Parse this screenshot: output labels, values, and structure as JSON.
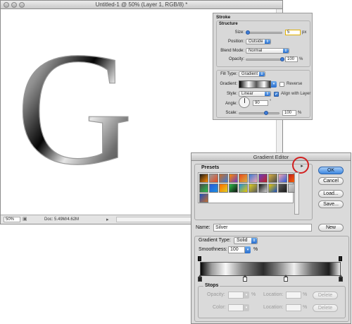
{
  "document": {
    "title": "Untitled-1 @ 50% (Layer 1, RGB/8) *",
    "zoom": "50%",
    "doc_info": "Doc: 5.49M/4.62M",
    "canvas_letter": "G"
  },
  "stroke_panel": {
    "title": "Stroke",
    "structure_heading": "Structure",
    "size_label": "Size:",
    "size_value": "5",
    "size_unit": "px",
    "size_slider_level": 0.05,
    "position_label": "Position:",
    "position_value": "Outside",
    "blend_label": "Blend Mode:",
    "blend_value": "Normal",
    "opacity_label": "Opacity:",
    "opacity_value": "100",
    "opacity_unit": "%",
    "fill_type_label": "Fill Type:",
    "fill_type_value": "Gradient",
    "gradient_label": "Gradient:",
    "reverse_label": "Reverse",
    "reverse_checked": false,
    "style_label": "Style:",
    "style_value": "Linear",
    "align_label": "Align with Layer",
    "align_checked": true,
    "angle_label": "Angle:",
    "angle_value": "90",
    "angle_unit": "°",
    "scale_label": "Scale:",
    "scale_value": "100",
    "scale_unit": "%"
  },
  "gradient_editor": {
    "title": "Gradient Editor",
    "presets_label": "Presets",
    "ok_label": "OK",
    "cancel_label": "Cancel",
    "load_label": "Load...",
    "save_label": "Save...",
    "name_label": "Name:",
    "name_value": "Silver",
    "new_label": "New",
    "gradient_type_label": "Gradient Type:",
    "gradient_type_value": "Solid",
    "smoothness_label": "Smoothness:",
    "smoothness_value": "100",
    "smoothness_unit": "%",
    "stops_label": "Stops",
    "opacity_label": "Opacity:",
    "opacity_unit": "%",
    "location_label": "Location:",
    "location_unit": "%",
    "delete_label": "Delete",
    "color_label": "Color:",
    "location2_label": "Location:",
    "location2_unit": "%",
    "delete2_label": "Delete",
    "presets": [
      "#1a1a1a",
      "#9a9a9a",
      "#c86c2a",
      "#ff8a00",
      "#e84a1c",
      "#3a7bd5",
      "#6a3cc0",
      "#d8b040",
      "#f4a6b0",
      "#c02020",
      "#4a4a4a",
      "#2a5ad8",
      "#ff6a00",
      "#2bbf4a",
      "#1c8fe0",
      "#e0d020",
      "#111111",
      "#e8c800",
      "#5a5a5a",
      "#d0d0d0",
      "#1a50c0"
    ],
    "color_stop_locations": [
      0.0,
      0.32,
      0.61,
      1.0
    ],
    "opacity_stop_locations": [
      0.0,
      1.0
    ]
  },
  "colors": {
    "accent_blue": "#3e88e0",
    "highlight_red": "#d21f1f"
  }
}
